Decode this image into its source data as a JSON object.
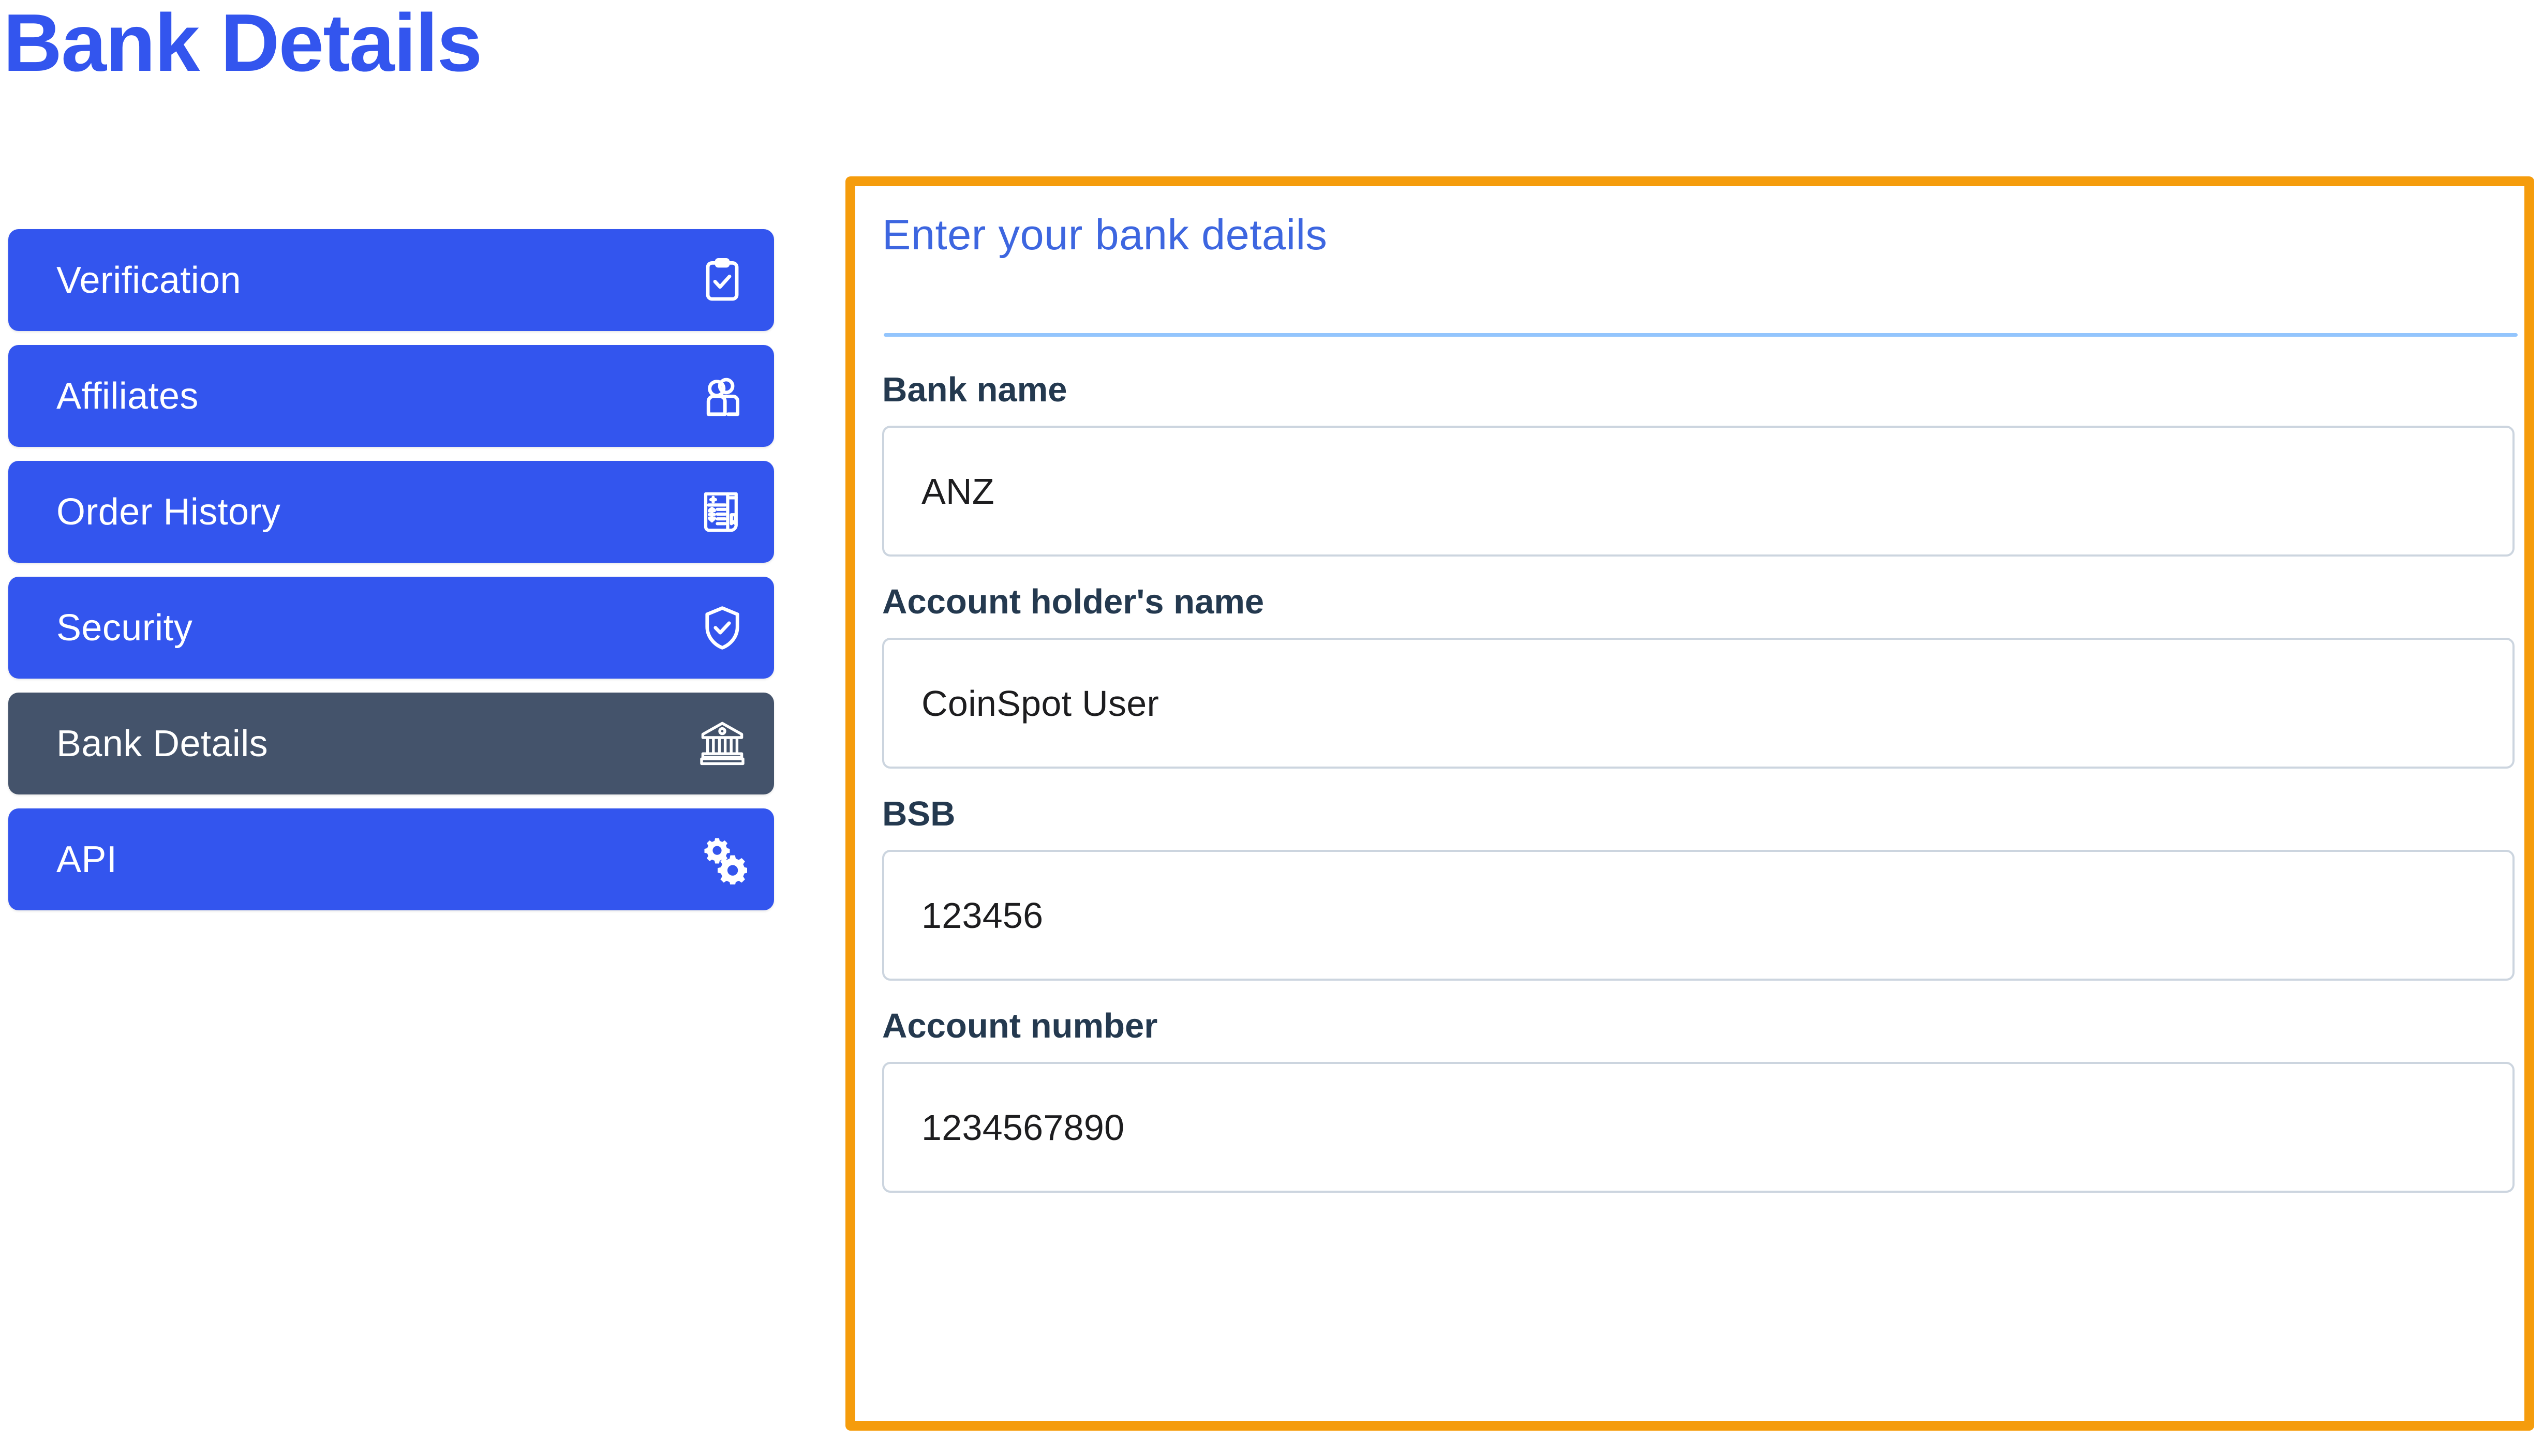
{
  "page": {
    "title": "Bank Details"
  },
  "theme": {
    "brand_blue": "#3355ee",
    "active_nav": "#44536b",
    "highlight_orange": "#f59c0c",
    "heading_blue": "#3d66e0",
    "divider_blue": "#93c5fd",
    "label_navy": "#24394f",
    "input_border": "#ccd5df"
  },
  "sidebar": {
    "items": [
      {
        "label": "Verification",
        "icon": "clipboard-check-icon",
        "active": false
      },
      {
        "label": "Affiliates",
        "icon": "users-icon",
        "active": false
      },
      {
        "label": "Order History",
        "icon": "invoice-receipt-icon",
        "active": false
      },
      {
        "label": "Security",
        "icon": "shield-check-icon",
        "active": false
      },
      {
        "label": "Bank Details",
        "icon": "bank-building-icon",
        "active": true
      },
      {
        "label": "API",
        "icon": "gears-icon",
        "active": false
      }
    ]
  },
  "panel": {
    "heading": "Enter your bank details",
    "fields": [
      {
        "label": "Bank name",
        "value": "ANZ",
        "name": "bank-name"
      },
      {
        "label": "Account holder's name",
        "value": "CoinSpot User",
        "name": "account-holder-name"
      },
      {
        "label": "BSB",
        "value": "123456",
        "name": "bsb"
      },
      {
        "label": "Account number",
        "value": "1234567890",
        "name": "account-number"
      }
    ]
  }
}
